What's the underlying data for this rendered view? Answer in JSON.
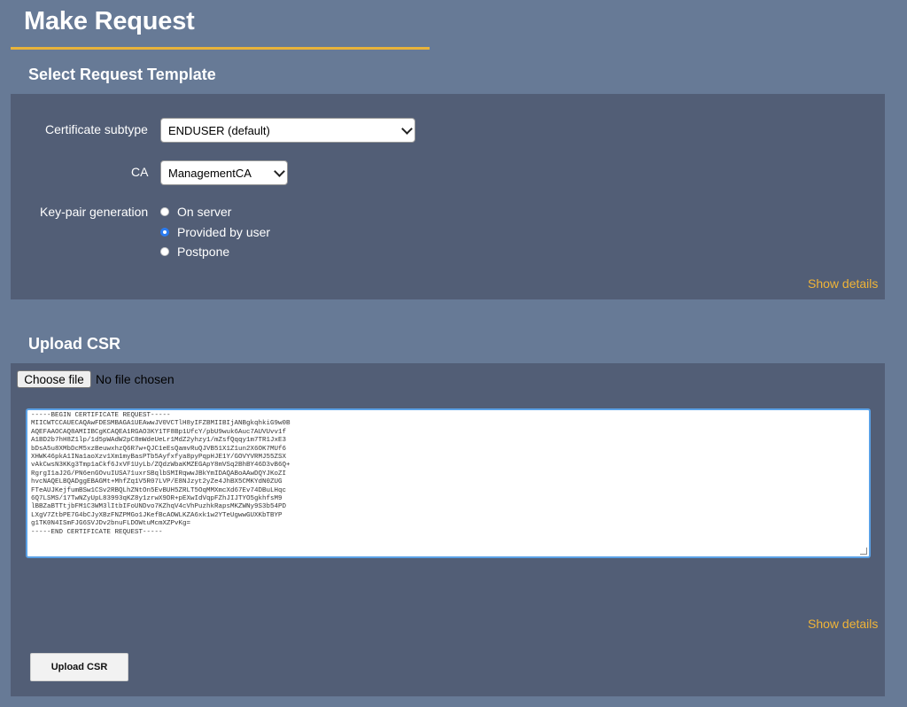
{
  "page": {
    "title": "Make Request"
  },
  "template_section": {
    "title": "Select Request Template",
    "certificate_subtype": {
      "label": "Certificate subtype",
      "value": "ENDUSER (default)"
    },
    "ca": {
      "label": "CA",
      "value": "ManagementCA"
    },
    "keypair": {
      "label": "Key-pair generation",
      "options": [
        "On server",
        "Provided by user",
        "Postpone"
      ],
      "selected": "Provided by user"
    },
    "show_details": "Show details"
  },
  "csr_section": {
    "title": "Upload CSR",
    "file_button": "Choose file",
    "file_status": "No file chosen",
    "csr_text": "-----BEGIN CERTIFICATE REQUEST-----\nMIICWTCCAUECAQAwFDESMBAGA1UEAwwJV0VCTlH8yIFZBMIIBIjANBgkqhkiG9w0B\nAQEFAAOCAQ8AMIIBCgKCAQEA1RGAO3KY1TF8Bp1UfcY/pbU9wuk6Auc7AUVUvv1f\nA1BD2b7hH8Z1lp/1d5pWAdW2pC8mWdeUeLr1MdZ2yhzy1/mZsfQqqy1m7TR1JxE3\nbDsA5u8XMbDcM5xzBeuwxhzQ6R7w+QJC1eEsQamvRuQJVB51X1Z1un2X6OK7MUf6\nXHWK46pkA1INa1aoXzv1Xm1myBasPTb5Ayfxfya8pyPqpHJE1Y/GOVYVRMJ55ZSX\nvAkCwsN3KKg3Tmp1aCkf6JxVF1UyLb/ZQdzWbaKMZEGApY8mVSq2BhBY46D3vB6Q+\nRgrgI1aJ2G/PN6enGOvuIUSA71uxrSBqlbSMIRqwwJBkYmIDAQABoAAwDQYJKoZI\nhvcNAQELBQADggEBAGMt+MhfZq1V5R07LVP/E8NJzyt2yZe4JhBX5CMKYdN0ZUG\nFTeAUJKejfumBSw1CSv2RBQLhZNtOn5EvBUH5ZRLT5OqMMXmcXd67Ev74DBuLHqc\n6Q7LSMS/17TwNZyUpL83993qKZ8y1zrwX9DR+pEXwIdVqpFZhJIJTYO5gkhfsM9\nlBBZaBTTtjbFM1C3WM3lItbIFoUNDvo7KZhqV4cVhPuzhkRapsMKZWNy9S3b54PD\nLXgV7ZtbPE7G4bCJyXBzFNZPMGo1JKefBcAOWLKZA6xk1w2YTeUgwwGUXKbTBYP\ng1TK0N4ISmFJG6SVJDv2bnuFLDOWtuMcmXZPvKg=\n-----END CERTIFICATE REQUEST-----",
    "show_details": "Show details",
    "upload_button": "Upload CSR"
  },
  "colors": {
    "background": "#677a96",
    "panel": "#525e76",
    "accent": "#e8b33a",
    "link": "#f0b437"
  }
}
